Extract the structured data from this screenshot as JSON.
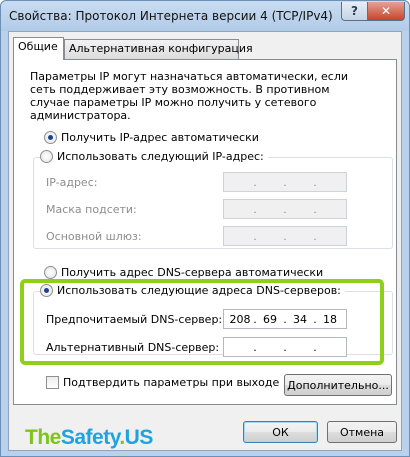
{
  "window": {
    "title": "Свойства: Протокол Интернета версии 4 (TCP/IPv4)",
    "help_label": "?",
    "close_label": "✕"
  },
  "tabs": [
    {
      "label": "Общие",
      "active": true
    },
    {
      "label": "Альтернативная конфигурация",
      "active": false
    }
  ],
  "intro_text": "Параметры IP могут назначаться автоматически, если сеть поддерживает эту возможность. В противном случае параметры IP можно получить у сетевого администратора.",
  "ip_section": {
    "auto_label": "Получить IP-адрес автоматически",
    "auto_selected": true,
    "manual_label": "Использовать следующий IP-адрес:",
    "manual_selected": false,
    "fields": [
      {
        "label": "IP-адрес:",
        "value": [
          " ",
          " ",
          " ",
          " "
        ]
      },
      {
        "label": "Маска подсети:",
        "value": [
          " ",
          " ",
          " ",
          " "
        ]
      },
      {
        "label": "Основной шлюз:",
        "value": [
          " ",
          " ",
          " ",
          " "
        ]
      }
    ]
  },
  "dns_section": {
    "auto_label": "Получить адрес DNS-сервера автоматически",
    "auto_selected": false,
    "manual_label": "Использовать следующие адреса DNS-серверов:",
    "manual_selected": true,
    "preferred": {
      "label": "Предпочитаемый DNS-сервер:",
      "octets": [
        "208",
        "69",
        "34",
        "18"
      ]
    },
    "alternate": {
      "label": "Альтернативный DNS-сервер:",
      "octets": [
        "",
        "",
        "",
        ""
      ]
    }
  },
  "validate_label": "Подтвердить параметры при выходе",
  "validate_checked": false,
  "advanced_label": "Дополнительно...",
  "ok_label": "ОК",
  "cancel_label": "Отмена",
  "watermark": {
    "part1": "The",
    "part2": "Safety",
    "part3": ".",
    "part4": "US"
  },
  "colors": {
    "highlight": "#8ed019",
    "watermark_green": "#7fc41c",
    "watermark_blue": "#1da3e1"
  }
}
